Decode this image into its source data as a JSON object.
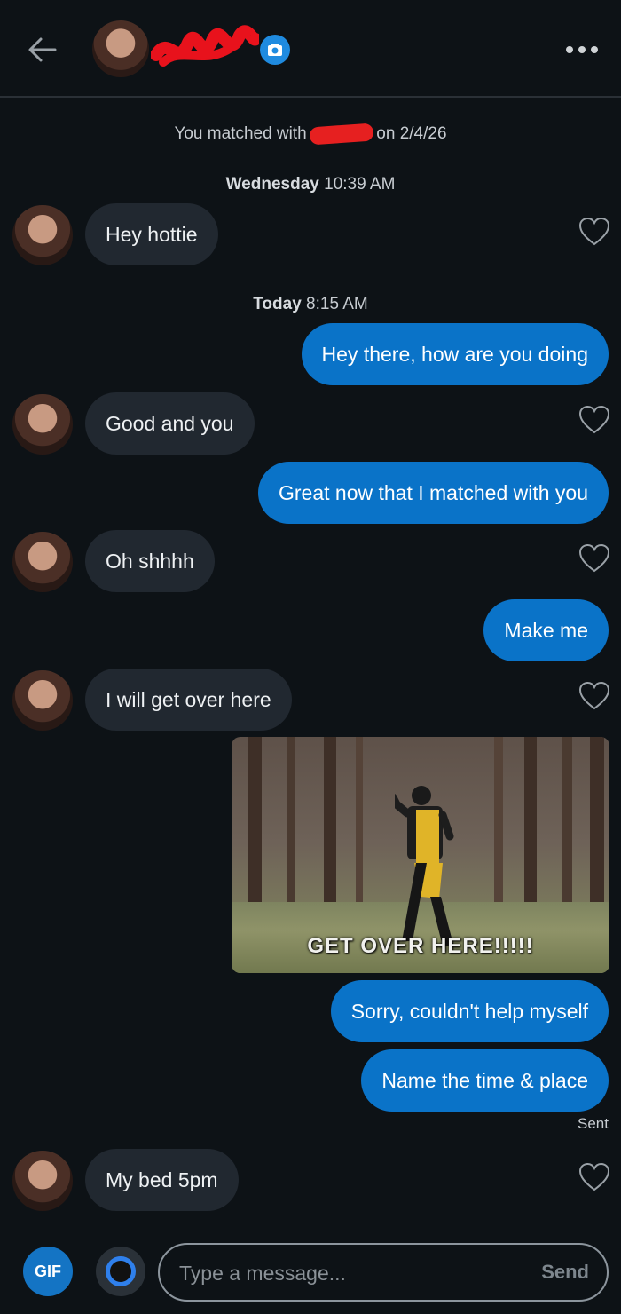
{
  "header": {
    "back_icon": "arrow-left-icon",
    "camera_icon": "camera-icon",
    "more_icon": "more-horizontal-icon"
  },
  "matched": {
    "prefix": "You matched with",
    "suffix": "on 2/4/26"
  },
  "timestamps": [
    {
      "day": "Wednesday",
      "time": "10:39 AM"
    },
    {
      "day": "Today",
      "time": "8:15 AM"
    }
  ],
  "messages": [
    {
      "from": "them",
      "text": "Hey hottie"
    },
    {
      "from": "me",
      "text": "Hey there, how are you doing"
    },
    {
      "from": "them",
      "text": "Good and you"
    },
    {
      "from": "me",
      "text": "Great now that I matched with you"
    },
    {
      "from": "them",
      "text": "Oh shhhh"
    },
    {
      "from": "me",
      "text": "Make me"
    },
    {
      "from": "them",
      "text": "I will get over here"
    },
    {
      "from": "me",
      "type": "gif",
      "caption": "GET OVER HERE!!!!!"
    },
    {
      "from": "me",
      "text": "Sorry, couldn't help myself"
    },
    {
      "from": "me",
      "text": "Name the time & place"
    },
    {
      "from": "them",
      "text": "My bed 5pm"
    }
  ],
  "status": {
    "sent": "Sent"
  },
  "composer": {
    "gif_label": "GIF",
    "placeholder": "Type a message...",
    "send_label": "Send"
  },
  "colors": {
    "background": "#0d1216",
    "incoming_bubble": "#212830",
    "outgoing_bubble": "#0a73c8",
    "accent": "#1f8be0"
  }
}
